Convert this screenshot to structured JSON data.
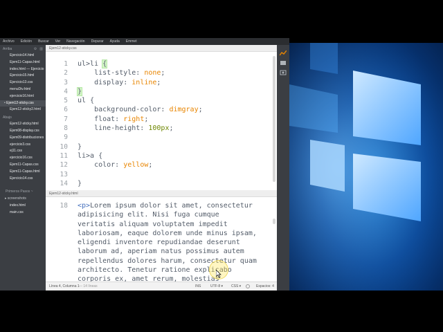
{
  "menubar": [
    "Archivo",
    "Edición",
    "Buscar",
    "Ver",
    "Navegación",
    "Depurar",
    "Ayuda",
    "Emmet"
  ],
  "sidebar": {
    "working_title": "Arriba",
    "working_files": [
      {
        "name": "Ejercicio14.html"
      },
      {
        "name": "Ejem11-Capas.html"
      },
      {
        "name": "index.html — Ejercicio"
      },
      {
        "name": "Ejercicio15.html"
      },
      {
        "name": "Ejercicio13.css"
      },
      {
        "name": "menuDiv.html"
      },
      {
        "name": "ejercicio16.html"
      },
      {
        "name": "Ejem12-sticky.css",
        "active": true
      },
      {
        "name": "Ejem12-sticky2.html"
      }
    ],
    "below_title": "Abajo",
    "below_files": [
      {
        "name": "Ejem12-sticky.html"
      },
      {
        "name": "Ejem08-display.css"
      },
      {
        "name": "Ejem09-distribuciones"
      },
      {
        "name": "ejercicio3.css"
      },
      {
        "name": "ej11.css"
      },
      {
        "name": "ejercicio16.css"
      },
      {
        "name": "Ejem11-Capas.css"
      },
      {
        "name": "Ejem11-Capas.html"
      },
      {
        "name": "Ejercicio14.css"
      }
    ],
    "project_title": "Primeros Pasos ~",
    "project_items": [
      {
        "name": "screenshots",
        "folder": true
      },
      {
        "name": "index.html"
      },
      {
        "name": "main.css"
      }
    ]
  },
  "top_pane": {
    "filename": "Ejem12-sticky.css",
    "lines": [
      {
        "num": "1",
        "html": "ul>li <span class=\"brace\">{</span>"
      },
      {
        "num": "2",
        "html": "    list-style: <span class=\"v\">none</span>;"
      },
      {
        "num": "3",
        "html": "    display: <span class=\"v\">inline</span>;"
      },
      {
        "num": "4",
        "html": "<span class=\"brace\">}</span>"
      },
      {
        "num": "5",
        "html": "ul {"
      },
      {
        "num": "6",
        "html": "    background-color: <span class=\"v\">dimgray</span>;"
      },
      {
        "num": "7",
        "html": "    float: <span class=\"v\">right</span>;"
      },
      {
        "num": "8",
        "html": "    line-height: <span class=\"n\">100px</span>;"
      },
      {
        "num": "9",
        "html": ""
      },
      {
        "num": "10",
        "html": "}"
      },
      {
        "num": "11",
        "html": "li>a {"
      },
      {
        "num": "12",
        "html": "    color: <span class=\"v\">yellow</span>;"
      },
      {
        "num": "13",
        "html": ""
      },
      {
        "num": "14",
        "html": "}"
      }
    ]
  },
  "bottom_pane": {
    "filename": "Ejem12-sticky.html",
    "lines": [
      {
        "num": "18",
        "html": "<span class=\"t\">&lt;p&gt;</span>Lorem ipsum dolor sit amet, consectetur"
      },
      {
        "num": "",
        "html": "adipisicing elit. Nisi fuga cumque"
      },
      {
        "num": "",
        "html": "veritatis aliquam voluptatem impedit"
      },
      {
        "num": "",
        "html": "laboriosam, eaque dolorem unde minus ipsam,"
      },
      {
        "num": "",
        "html": "eligendi inventore repudiandae deserunt"
      },
      {
        "num": "",
        "html": "laborum ad, aperiam natus possimus autem"
      },
      {
        "num": "",
        "html": "repellendus dolores harum, consectetur quam"
      },
      {
        "num": "",
        "html": "architecto. Tenetur ratione explicabo"
      },
      {
        "num": "",
        "html": "corporis ex, amet rerum, molestias"
      }
    ]
  },
  "statusbar": {
    "position": "Línea 4, Columna 1",
    "lines": "— 14 líneas",
    "mode": "INS",
    "encoding": "UTF-8 ▾",
    "language": "CSS ▾",
    "indent": "Espacios: 4"
  },
  "colors": {
    "accent": "#e88501",
    "sidebar_bg": "#3b3e43",
    "wallpaper": "#0d4c9c"
  }
}
